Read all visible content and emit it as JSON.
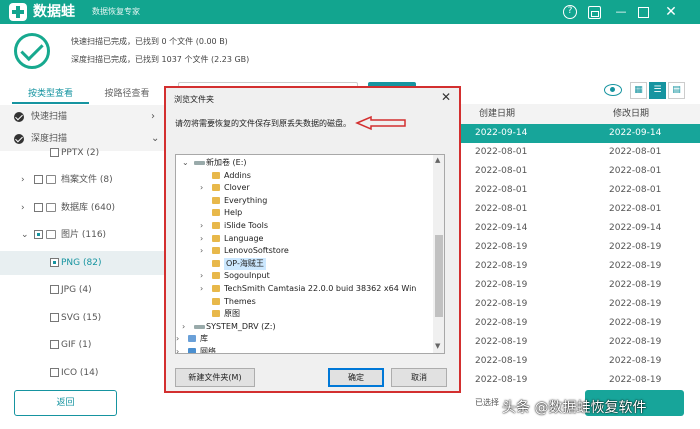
{
  "app": {
    "name": "数据蛙",
    "subtitle": "数据恢复专家"
  },
  "status": {
    "quick_scan": "快速扫描已完成，已找到 0 个文件 (0.00  B)",
    "deep_scan": "深度扫描已完成，已找到 1037 个文件 (2.23 GB)"
  },
  "tabs": [
    "按类型查看",
    "按路径查看"
  ],
  "sidebar": {
    "quick": "快速扫描",
    "deep": "深度扫描",
    "items": [
      {
        "label": "PPTX (2)"
      },
      {
        "label": "档案文件 (8)"
      },
      {
        "label": "数据库 (640)"
      },
      {
        "label": "图片 (116)"
      },
      {
        "label": "PNG (82)"
      },
      {
        "label": "JPG (4)"
      },
      {
        "label": "SVG (15)"
      },
      {
        "label": "GIF (1)"
      },
      {
        "label": "ICO (14)"
      }
    ],
    "back": "返回"
  },
  "table": {
    "col_created": "创建日期",
    "col_modified": "修改日期",
    "rows": [
      {
        "created": "2022-09-14",
        "modified": "2022-09-14"
      },
      {
        "created": "2022-08-01",
        "modified": "2022-08-01"
      },
      {
        "created": "2022-08-01",
        "modified": "2022-08-01"
      },
      {
        "created": "2022-08-01",
        "modified": "2022-08-01"
      },
      {
        "created": "2022-08-01",
        "modified": "2022-08-01"
      },
      {
        "created": "2022-09-14",
        "modified": "2022-09-14"
      },
      {
        "created": "2022-08-19",
        "modified": "2022-08-19"
      },
      {
        "created": "2022-08-19",
        "modified": "2022-08-19"
      },
      {
        "created": "2022-08-19",
        "modified": "2022-08-19"
      },
      {
        "created": "2022-08-19",
        "modified": "2022-08-19"
      },
      {
        "created": "2022-08-19",
        "modified": "2022-08-19"
      },
      {
        "created": "2022-08-19",
        "modified": "2022-08-19"
      },
      {
        "created": "2022-08-19",
        "modified": "2022-08-19"
      },
      {
        "created": "2022-08-19",
        "modified": "2022-08-19"
      }
    ],
    "footer": "已选择"
  },
  "dialog": {
    "title": "浏览文件夹",
    "prompt": "请勿将需要恢复的文件保存到原丢失数据的磁盘。",
    "tree": [
      {
        "label": "新加卷 (E:)"
      },
      {
        "label": "Addins"
      },
      {
        "label": "Clover"
      },
      {
        "label": "Everything"
      },
      {
        "label": "Help"
      },
      {
        "label": "iSlide Tools"
      },
      {
        "label": "Language"
      },
      {
        "label": "LenovoSoftstore"
      },
      {
        "label": "OP-海贼王"
      },
      {
        "label": "SogouInput"
      },
      {
        "label": "TechSmith Camtasia 22.0.0 buid 38362 x64 Win"
      },
      {
        "label": "Themes"
      },
      {
        "label": "原图"
      },
      {
        "label": "SYSTEM_DRV (Z:)"
      },
      {
        "label": "库"
      },
      {
        "label": "网络"
      }
    ],
    "new_folder": "新建文件夹(M)",
    "ok": "确定",
    "cancel": "取消"
  },
  "watermark": "头条 @数据蛙恢复软件",
  "colors": {
    "brand": "#12a58f",
    "accent": "#1694a0",
    "highlight": "#d32f2f"
  }
}
